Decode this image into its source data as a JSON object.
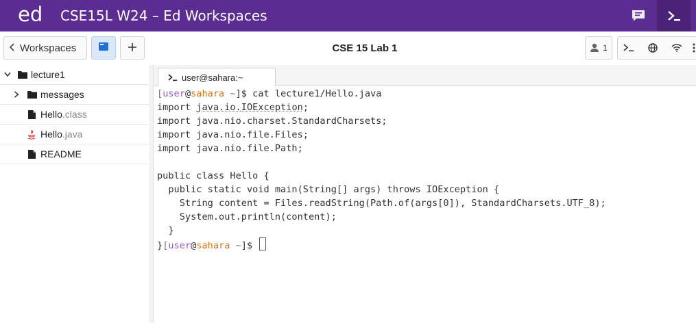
{
  "header": {
    "logo": "ed",
    "title": "CSE15L W24 – Ed Workspaces",
    "icons": [
      "chat-icon",
      "terminal-icon"
    ]
  },
  "toolbar": {
    "workspaces_label": "Workspaces",
    "document_title": "CSE 15 Lab 1",
    "user_count": "1",
    "icons": [
      "files-icon",
      "plus-icon",
      "user-icon",
      "terminal-icon",
      "globe-icon",
      "wifi-icon",
      "more-icon"
    ]
  },
  "sidebar": {
    "items": [
      {
        "name": "lecture1",
        "kind": "folder",
        "expanded": true
      },
      {
        "name": "messages",
        "kind": "folder",
        "expanded": false
      },
      {
        "name": "Hello",
        "ext": ".class",
        "kind": "file"
      },
      {
        "name": "Hello",
        "ext": ".java",
        "kind": "java-file"
      },
      {
        "name": "README",
        "kind": "file"
      }
    ]
  },
  "terminal": {
    "tab_label": "user@sahara:~",
    "prompt": {
      "open": "[",
      "user": "user",
      "at": "@",
      "host": "sahara",
      "path": " ~",
      "close": "]$ "
    },
    "command": "cat lecture1/Hello.java",
    "import_prefix": "import ",
    "import_io_pkg": "java.io.",
    "import_io_cls": "IOException",
    "import_io_end": ";",
    "lines": [
      "import java.nio.charset.StandardCharsets;",
      "import java.nio.file.Files;",
      "import java.nio.file.Path;",
      "",
      "public class Hello {",
      "  public static void main(String[] args) throws IOException {",
      "    String content = Files.readString(Path.of(args[0]), StandardCharsets.UTF_8);",
      "    System.out.println(content);",
      "  }"
    ],
    "last_prefix": "}"
  },
  "colors": {
    "topbar": "#5b2c91",
    "prompt_user": "#9a55c9",
    "prompt_host": "#d8741c"
  }
}
